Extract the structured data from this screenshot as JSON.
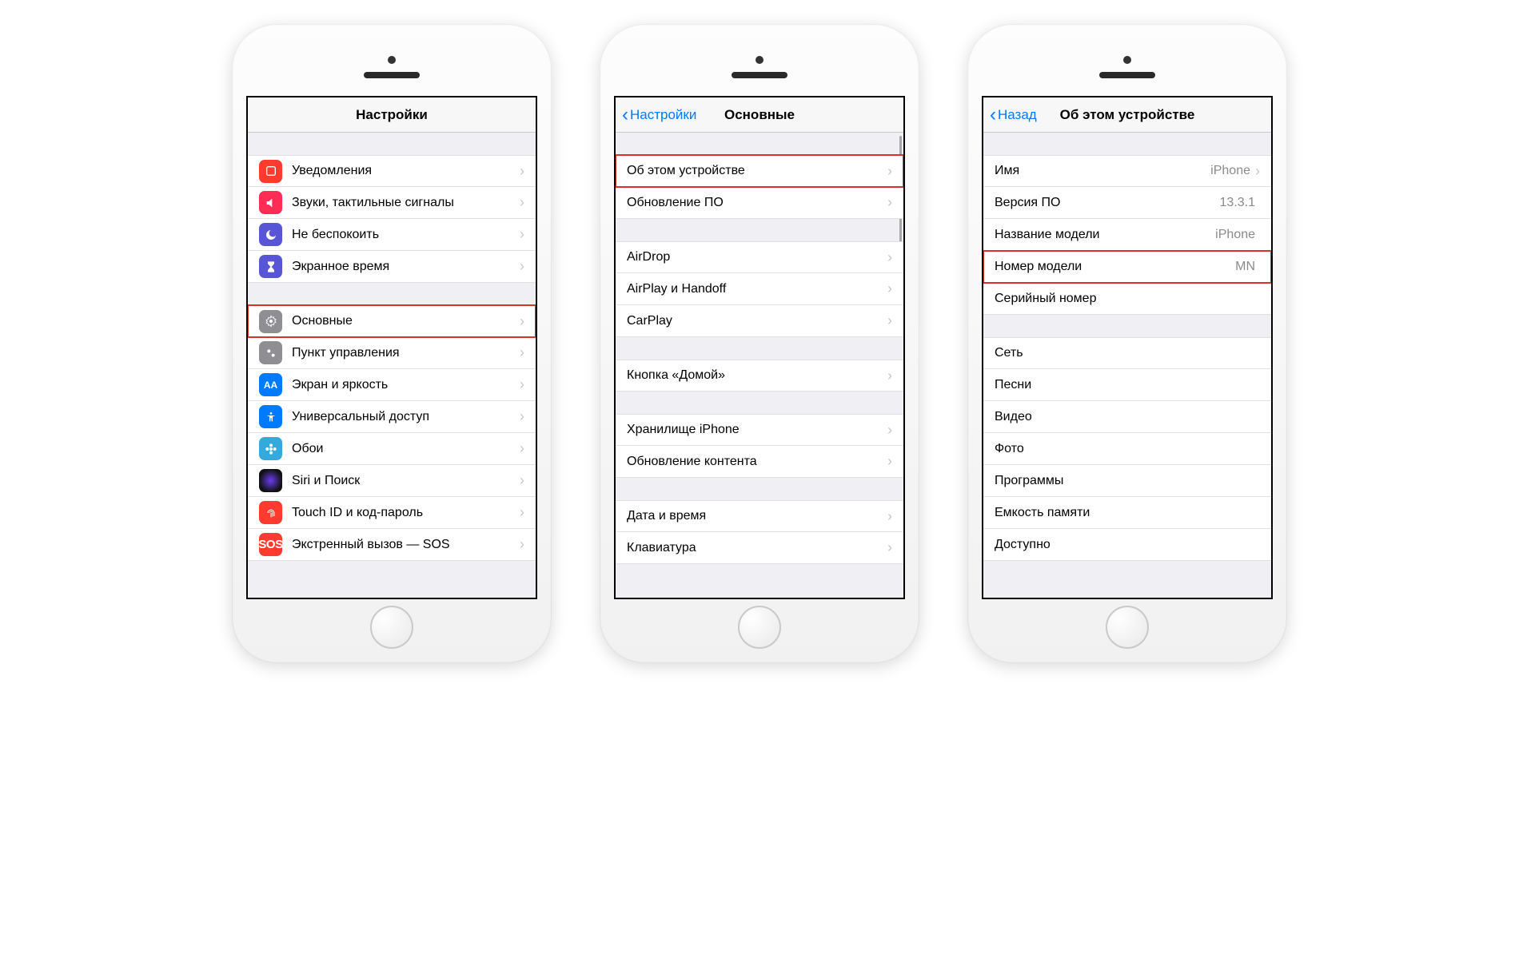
{
  "phone1": {
    "title": "Настройки",
    "items": [
      {
        "label": "Уведомления"
      },
      {
        "label": "Звуки, тактильные сигналы"
      },
      {
        "label": "Не беспокоить"
      },
      {
        "label": "Экранное время"
      }
    ],
    "items2": [
      {
        "label": "Основные"
      },
      {
        "label": "Пункт управления"
      },
      {
        "label": "Экран и яркость"
      },
      {
        "label": "Универсальный доступ"
      },
      {
        "label": "Обои"
      },
      {
        "label": "Siri и Поиск"
      },
      {
        "label": "Touch ID и код-пароль"
      },
      {
        "label": "Экстренный вызов — SOS"
      }
    ]
  },
  "phone2": {
    "back": "Настройки",
    "title": "Основные",
    "g1": [
      {
        "label": "Об этом устройстве"
      },
      {
        "label": "Обновление ПО"
      }
    ],
    "g2": [
      {
        "label": "AirDrop"
      },
      {
        "label": "AirPlay и Handoff"
      },
      {
        "label": "CarPlay"
      }
    ],
    "g3": [
      {
        "label": "Кнопка «Домой»"
      }
    ],
    "g4": [
      {
        "label": "Хранилище iPhone"
      },
      {
        "label": "Обновление контента"
      }
    ],
    "g5": [
      {
        "label": "Дата и время"
      },
      {
        "label": "Клавиатура"
      }
    ]
  },
  "phone3": {
    "back": "Назад",
    "title": "Об этом устройстве",
    "g1": [
      {
        "label": "Имя",
        "value": "iPhone",
        "chev": true
      },
      {
        "label": "Версия ПО",
        "value": "13.3.1"
      },
      {
        "label": "Название модели",
        "value": "iPhone"
      },
      {
        "label": "Номер модели",
        "value": "MN"
      },
      {
        "label": "Серийный номер",
        "value": ""
      }
    ],
    "g2": [
      {
        "label": "Сеть"
      },
      {
        "label": "Песни"
      },
      {
        "label": "Видео"
      },
      {
        "label": "Фото"
      },
      {
        "label": "Программы"
      },
      {
        "label": "Емкость памяти"
      },
      {
        "label": "Доступно"
      }
    ]
  }
}
